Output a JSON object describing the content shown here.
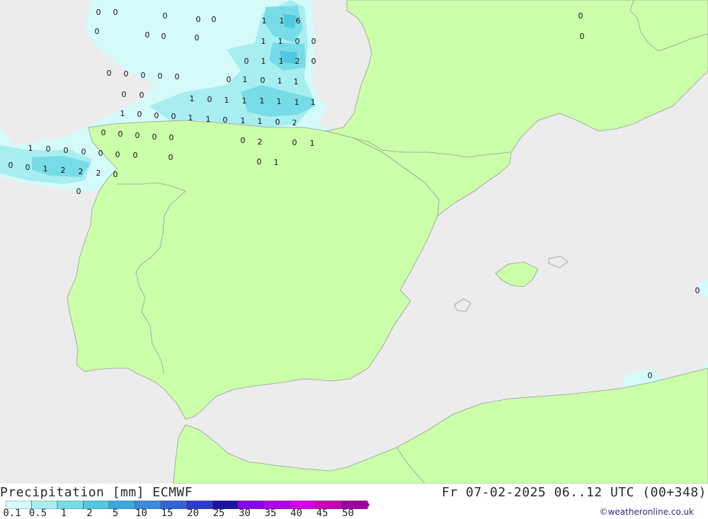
{
  "map": {
    "colors": {
      "sea": "#ececec",
      "land": "#ccffaa",
      "border": "#9a9a9a",
      "precip_light": "#d4fafa",
      "precip_mid": "#a8eef0",
      "precip_strong": "#78dce8",
      "precip_heavy": "#50c8e0"
    },
    "value_labels": [
      {
        "t": "0"
      },
      {
        "t": "0"
      },
      {
        "t": "0"
      },
      {
        "t": "0"
      },
      {
        "t": "0"
      },
      {
        "t": "0"
      },
      {
        "t": "0"
      },
      {
        "t": "0"
      },
      {
        "t": "0"
      },
      {
        "t": "1"
      },
      {
        "t": "1"
      },
      {
        "t": "6"
      },
      {
        "t": "1"
      },
      {
        "t": "1"
      },
      {
        "t": "0"
      },
      {
        "t": "0"
      },
      {
        "t": "0"
      },
      {
        "t": "1"
      },
      {
        "t": "1"
      },
      {
        "t": "2"
      },
      {
        "t": "0"
      },
      {
        "t": "0"
      },
      {
        "t": "0"
      },
      {
        "t": "0"
      },
      {
        "t": "0"
      },
      {
        "t": "0"
      },
      {
        "t": "0"
      },
      {
        "t": "1"
      },
      {
        "t": "0"
      },
      {
        "t": "1"
      },
      {
        "t": "1"
      },
      {
        "t": "0"
      },
      {
        "t": "0"
      },
      {
        "t": "1"
      },
      {
        "t": "0"
      },
      {
        "t": "1"
      },
      {
        "t": "1"
      },
      {
        "t": "1"
      },
      {
        "t": "1"
      },
      {
        "t": "1"
      },
      {
        "t": "1"
      },
      {
        "t": "1"
      },
      {
        "t": "0"
      },
      {
        "t": "0"
      },
      {
        "t": "0"
      },
      {
        "t": "1"
      },
      {
        "t": "1"
      },
      {
        "t": "0"
      },
      {
        "t": "1"
      },
      {
        "t": "1"
      },
      {
        "t": "0"
      },
      {
        "t": "2"
      },
      {
        "t": "0"
      },
      {
        "t": "0"
      },
      {
        "t": "0"
      },
      {
        "t": "0"
      },
      {
        "t": "0"
      },
      {
        "t": "0"
      },
      {
        "t": "2"
      },
      {
        "t": "0"
      },
      {
        "t": "1"
      },
      {
        "t": "1"
      },
      {
        "t": "0"
      },
      {
        "t": "0"
      },
      {
        "t": "0"
      },
      {
        "t": "0"
      },
      {
        "t": "0"
      },
      {
        "t": "0"
      },
      {
        "t": "0"
      },
      {
        "t": "0"
      },
      {
        "t": "1"
      },
      {
        "t": "2"
      },
      {
        "t": "2"
      },
      {
        "t": "2"
      },
      {
        "t": "0"
      },
      {
        "t": "0"
      },
      {
        "t": "1"
      },
      {
        "t": "0"
      },
      {
        "t": "0"
      },
      {
        "t": "0"
      },
      {
        "t": "0"
      },
      {
        "t": "0"
      },
      {
        "t": "0"
      },
      {
        "t": "0"
      }
    ]
  },
  "title_left": "Precipitation [mm] ECMWF",
  "title_right": "Fr 07-02-2025 06..12 UTC (00+348)",
  "legend": {
    "ticks": [
      "0.1",
      "0.5",
      "1",
      "2",
      "5",
      "10",
      "15",
      "20",
      "25",
      "30",
      "35",
      "40",
      "45",
      "50"
    ],
    "colors": [
      "#d4fafa",
      "#a8eef0",
      "#78dce8",
      "#50c8e0",
      "#3ca8e0",
      "#3a8ae0",
      "#3264d8",
      "#2a3cc8",
      "#1e14a0",
      "#8a00e6",
      "#b000e6",
      "#d400e6",
      "#c800b4",
      "#a000a0"
    ]
  },
  "credit": "©weatheronline.co.uk"
}
